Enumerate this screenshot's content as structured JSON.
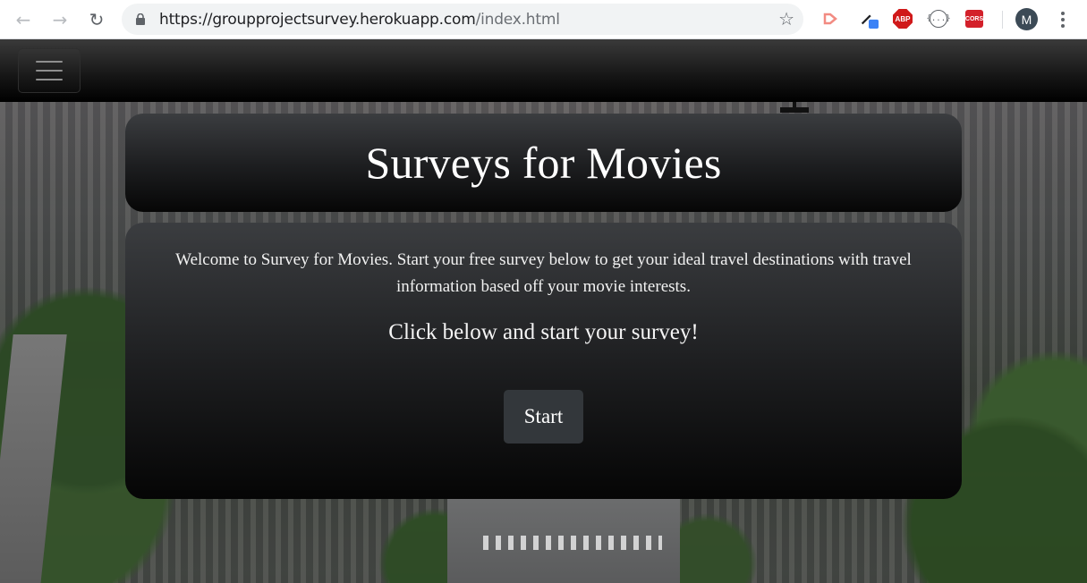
{
  "browser": {
    "url_host": "https://groupprojectsurvey.herokuapp.com",
    "url_path": "/index.html",
    "profile_initial": "M",
    "extensions": {
      "abp_label": "ABP",
      "cors_label": "CORS",
      "json_label": "{...}"
    }
  },
  "navbar": {
    "toggler_icon": "hamburger-icon"
  },
  "header": {
    "title": "Surveys for Movies"
  },
  "main": {
    "welcome_text": "Welcome to Survey for Movies. Start your free survey below to get your ideal travel destinations with travel information based off your movie interests.",
    "cta_text": "Click below and start your survey!",
    "start_label": "Start"
  },
  "colors": {
    "card_top": "#3b3d40",
    "card_bottom": "#050505",
    "button_bg": "#33373b",
    "text": "#ffffff"
  }
}
